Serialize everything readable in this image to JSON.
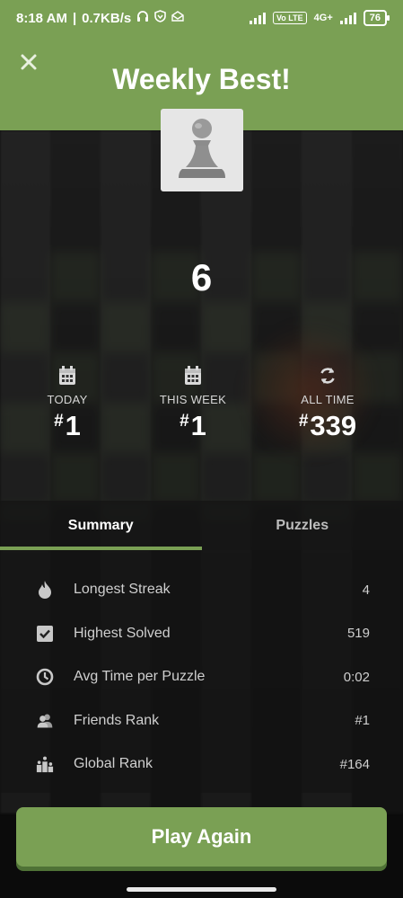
{
  "status_bar": {
    "time": "8:18 AM",
    "speed": "0.7KB/s",
    "volte": "Vo LTE",
    "network": "4G+",
    "battery": "76"
  },
  "header": {
    "title": "Weekly Best!"
  },
  "score": "6",
  "ranks": [
    {
      "label": "TODAY",
      "hash": "#",
      "value": "1",
      "icon": "calendar-icon"
    },
    {
      "label": "THIS WEEK",
      "hash": "#",
      "value": "1",
      "icon": "calendar-icon"
    },
    {
      "label": "ALL TIME",
      "hash": "#",
      "value": "339",
      "icon": "refresh-icon"
    }
  ],
  "tabs": [
    {
      "label": "Summary",
      "active": true
    },
    {
      "label": "Puzzles",
      "active": false
    }
  ],
  "summary": [
    {
      "label": "Longest Streak",
      "value": "4",
      "icon": "flame-icon"
    },
    {
      "label": "Highest Solved",
      "value": "519",
      "icon": "checkbox-icon"
    },
    {
      "label": "Avg Time per Puzzle",
      "value": "0:02",
      "icon": "clock-icon"
    },
    {
      "label": "Friends Rank",
      "value": "#1",
      "icon": "friends-icon"
    },
    {
      "label": "Global Rank",
      "value": "#164",
      "icon": "podium-icon"
    }
  ],
  "play_button": "Play Again",
  "colors": {
    "accent": "#7aa054",
    "accent_dark": "#4f7236",
    "text_muted": "#cfcfcf"
  }
}
